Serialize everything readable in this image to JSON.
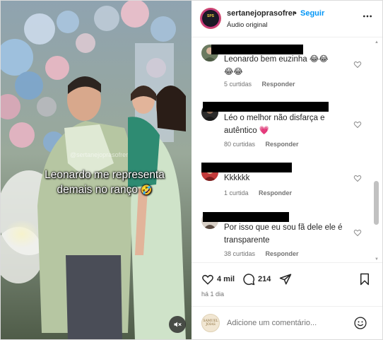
{
  "post": {
    "username": "sertanejoprasofrer",
    "separator": "•",
    "follow_label": "Seguir",
    "audio_label": "Áudio original",
    "avatar_text": "SERTANEJO PRA SOFRER"
  },
  "media": {
    "watermark": "@sertanejoprasofrer",
    "caption": "Leonardo me representa demais no ranço",
    "caption_emoji": "🤣",
    "mute_icon": "speaker-muted-icon"
  },
  "comments": [
    {
      "text": "Leonardo bem euzinha 😂😂\n😂😂",
      "likes": "5 curtidas",
      "reply": "Responder"
    },
    {
      "text": "Léo o melhor não disfarça e autêntico 💗",
      "likes": "80 curtidas",
      "reply": "Responder"
    },
    {
      "text": "Kkkkkk",
      "likes": "1 curtida",
      "reply": "Responder"
    },
    {
      "text": "Por isso que eu sou fã dele ele é transparente",
      "likes": "38 curtidas",
      "reply": "Responder"
    }
  ],
  "actions": {
    "likes_count": "4 mil",
    "comments_count": "214",
    "time_ago": "há 1 dia"
  },
  "add_comment": {
    "placeholder": "Adicione um comentário...",
    "avatar_text": "SAMUEL JOIAS"
  },
  "colors": {
    "accent": "#0095f6",
    "text": "#262626",
    "secondary": "#737373"
  }
}
